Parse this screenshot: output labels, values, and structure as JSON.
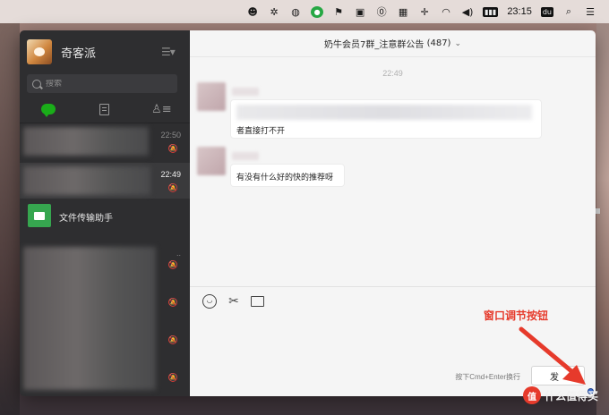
{
  "menubar": {
    "icons": [
      "person-circle",
      "network",
      "wechat",
      "wechat-active",
      "flag",
      "dock",
      "pause",
      "grid",
      "cross",
      "wifi",
      "volume",
      "battery"
    ],
    "battery_label": "",
    "time": "23:15",
    "du_label": "du",
    "search_icon": "search",
    "list_icon": "list"
  },
  "sidebar": {
    "profile_name": "奇客派",
    "search_placeholder": "搜索",
    "tabs": [
      {
        "icon": "chat-bubble",
        "active": true
      },
      {
        "icon": "document"
      },
      {
        "icon": "contacts"
      }
    ],
    "conversations": [
      {
        "time": "22:50",
        "muted": true,
        "active": false
      },
      {
        "time": "22:49",
        "muted": true,
        "active": true
      }
    ],
    "file_helper": {
      "name": "文件传输助手"
    },
    "more_time": ".."
  },
  "chat": {
    "title": "奶牛会员7群_注意群公告",
    "count": "(487)",
    "time_separator": "22:49",
    "messages": [
      {
        "text": "者直接打不开"
      },
      {
        "text": "有没有什么好的快的推荐呀"
      }
    ],
    "input": {
      "hint": "按下Cmd+Enter换行",
      "send_label": "发"
    }
  },
  "annotation": {
    "label": "窗口调节按钮",
    "color": "#e63a2b"
  },
  "watermark": {
    "badge": "值",
    "text": "什么值得买"
  },
  "colors": {
    "accent_green": "#1aad19",
    "sidebar_bg": "#2e2e30",
    "chat_bg": "#f5f5f5"
  }
}
